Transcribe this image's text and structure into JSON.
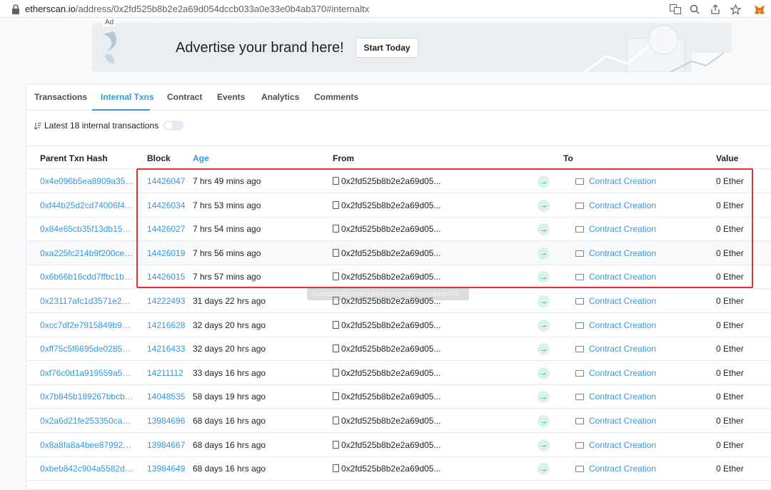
{
  "browser": {
    "url_host": "etherscan.io",
    "url_path": "/address/0x2fd525b8b2e2a69d054dccb033a0e33e0b4ab370#internaltx"
  },
  "ad": {
    "label": "Ad",
    "headline": "Advertise your brand here!",
    "button": "Start Today"
  },
  "tabs": [
    "Transactions",
    "Internal Txns",
    "Contract",
    "Events",
    "Analytics",
    "Comments"
  ],
  "subheader": "Latest 18 internal transactions",
  "columns": {
    "parent_hash": "Parent Txn Hash",
    "block": "Block",
    "age": "Age",
    "from": "From",
    "to": "To",
    "value": "Value"
  },
  "rows": [
    {
      "hash": "0x4e096b5ea8909a3550...",
      "block": "14426047",
      "age": "7 hrs 49 mins ago",
      "from": "0x2fd525b8b2e2a69d05...",
      "to": "Contract Creation",
      "value": "0 Ether"
    },
    {
      "hash": "0xf44b25d2cd74006f48c...",
      "block": "14426034",
      "age": "7 hrs 53 mins ago",
      "from": "0x2fd525b8b2e2a69d05...",
      "to": "Contract Creation",
      "value": "0 Ether"
    },
    {
      "hash": "0x84e65cb35f13db15a4...",
      "block": "14426027",
      "age": "7 hrs 54 mins ago",
      "from": "0x2fd525b8b2e2a69d05...",
      "to": "Contract Creation",
      "value": "0 Ether"
    },
    {
      "hash": "0xa225fc214b9f200ce58...",
      "block": "14426019",
      "age": "7 hrs 56 mins ago",
      "from": "0x2fd525b8b2e2a69d05...",
      "to": "Contract Creation",
      "value": "0 Ether"
    },
    {
      "hash": "0x6b66b16cdd7ffbc1bf83...",
      "block": "14426015",
      "age": "7 hrs 57 mins ago",
      "from": "0x2fd525b8b2e2a69d05...",
      "to": "Contract Creation",
      "value": "0 Ether"
    },
    {
      "hash": "0x23117afc1d3571e276...",
      "block": "14222493",
      "age": "31 days 22 hrs ago",
      "from": "0x2fd525b8b2e2a69d05...",
      "to": "Contract Creation",
      "value": "0 Ether"
    },
    {
      "hash": "0xcc7df2e7915849b99c9...",
      "block": "14216628",
      "age": "32 days 20 hrs ago",
      "from": "0x2fd525b8b2e2a69d05...",
      "to": "Contract Creation",
      "value": "0 Ether"
    },
    {
      "hash": "0xff75c5f6695de028520...",
      "block": "14216433",
      "age": "32 days 20 hrs ago",
      "from": "0x2fd525b8b2e2a69d05...",
      "to": "Contract Creation",
      "value": "0 Ether"
    },
    {
      "hash": "0xf76c0d1a919559a542...",
      "block": "14211112",
      "age": "33 days 16 hrs ago",
      "from": "0x2fd525b8b2e2a69d05...",
      "to": "Contract Creation",
      "value": "0 Ether"
    },
    {
      "hash": "0x7b845b189267bbcbed...",
      "block": "14048535",
      "age": "58 days 19 hrs ago",
      "from": "0x2fd525b8b2e2a69d05...",
      "to": "Contract Creation",
      "value": "0 Ether"
    },
    {
      "hash": "0x2a6d21fe253350cae9...",
      "block": "13984696",
      "age": "68 days 16 hrs ago",
      "from": "0x2fd525b8b2e2a69d05...",
      "to": "Contract Creation",
      "value": "0 Ether"
    },
    {
      "hash": "0x8a8fa8a4bee879923e...",
      "block": "13984667",
      "age": "68 days 16 hrs ago",
      "from": "0x2fd525b8b2e2a69d05...",
      "to": "Contract Creation",
      "value": "0 Ether"
    },
    {
      "hash": "0xbeb842c904a5582d84...",
      "block": "13984649",
      "age": "68 days 16 hrs ago",
      "from": "0x2fd525b8b2e2a69d05...",
      "to": "Contract Creation",
      "value": "0 Ether"
    }
  ],
  "tooltip": "0x2fd525b8b2e2a69d054dccb033a0e33e0b4ab370",
  "colors": {
    "link": "#3498db",
    "highlight": "#e03434",
    "arrow": "#00a186"
  }
}
